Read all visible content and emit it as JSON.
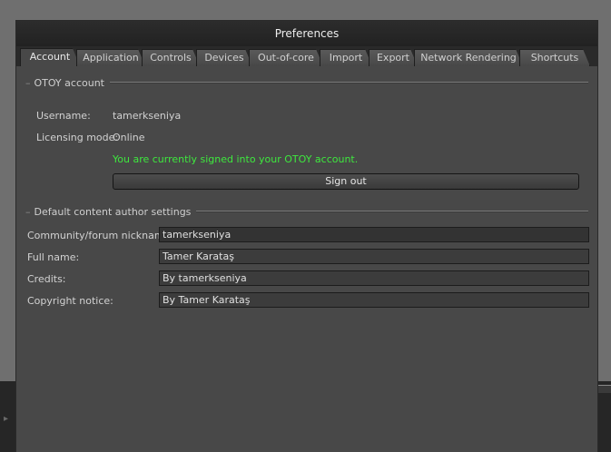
{
  "window": {
    "title": "Preferences"
  },
  "tabs": [
    {
      "label": "Account",
      "active": true
    },
    {
      "label": "Application",
      "active": false
    },
    {
      "label": "Controls",
      "active": false
    },
    {
      "label": "Devices",
      "active": false
    },
    {
      "label": "Out-of-core",
      "active": false
    },
    {
      "label": "Import",
      "active": false
    },
    {
      "label": "Export",
      "active": false
    },
    {
      "label": "Network Rendering",
      "active": false
    },
    {
      "label": "Shortcuts",
      "active": false
    }
  ],
  "otoy_account": {
    "section_title": "OTOY account",
    "username_label": "Username:",
    "username": "tamerkseniya",
    "licensing_label": "Licensing mode:",
    "licensing_mode": "Online",
    "status_message": "You are currently signed into your OTOY account.",
    "sign_out_label": "Sign out"
  },
  "author_settings": {
    "section_title": "Default content author settings",
    "nickname_label": "Community/forum nickname:",
    "nickname": "tamerkseniya",
    "full_name_label": "Full name:",
    "full_name": "Tamer Karataş",
    "credits_label": "Credits:",
    "credits": "By tamerkseniya",
    "copyright_label": "Copyright notice:",
    "copyright": "By Tamer Karataş"
  },
  "colors": {
    "status_green": "#3ee83e",
    "panel": "#484848",
    "titlebar": "#262626"
  }
}
